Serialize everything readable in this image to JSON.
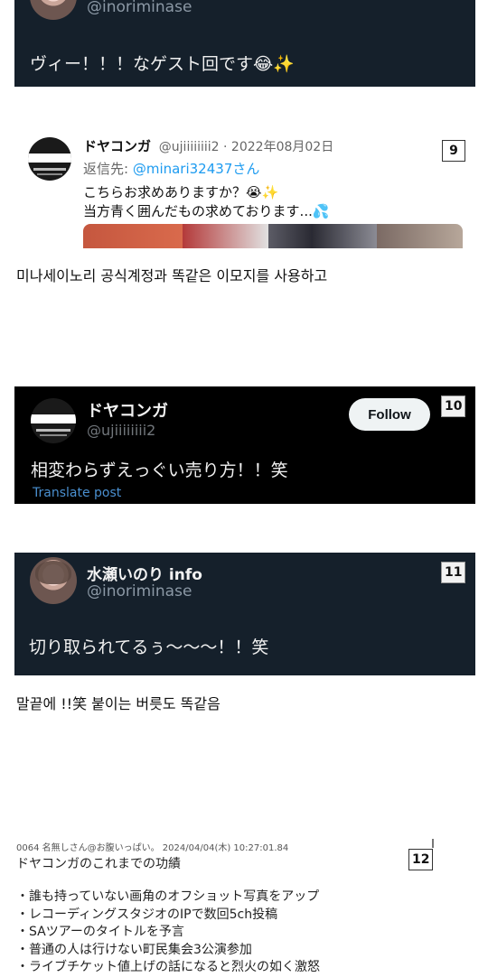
{
  "tweet1": {
    "handle": "@inoriminase",
    "text": "ヴィー！！！なゲスト回です😂✨"
  },
  "tweet2": {
    "name": "ドヤコンガ",
    "handle_date": "@ujiiiiiiii2 · 2022年08月02日",
    "reply_prefix": "返信先: ",
    "reply_to": "@minari32437さん",
    "line1": "こちらお求めありますか？😭✨",
    "line2": "当方青く囲んだもの求めております...💦",
    "badge": "9"
  },
  "caption1": "미나세이노리 공식계정과 똑같은 이모지를 사용하고",
  "tweet3": {
    "name": "ドヤコンガ",
    "handle": "@ujiiiiiiii2",
    "follow_label": "Follow",
    "text": "相変わらずえっぐい売り方！！笑",
    "translate": "Translate post",
    "badge": "10"
  },
  "tweet4": {
    "name": "水瀬いのり info",
    "handle": "@inoriminase",
    "text": "切り取られてるぅ〜〜〜！！笑",
    "badge": "11"
  },
  "caption2": "말끝에 !!笑 붙이는 버릇도 똑같음",
  "post": {
    "meta": "0064 名無しさん@お腹いっぱい。 2024/04/04(木) 10:27:01.84",
    "title": "ドヤコンガのこれまでの功績",
    "badge": "12",
    "items": [
      "・誰も持っていない画角のオフショット写真をアップ",
      "・レコーディングスタジオのIPで数回5ch投稿",
      "・SAツアーのタイトルを予言",
      "・普通の人は行けない町民集会3公演参加",
      "・ライブチケット値上げの話になると烈火の如く激怒"
    ]
  }
}
